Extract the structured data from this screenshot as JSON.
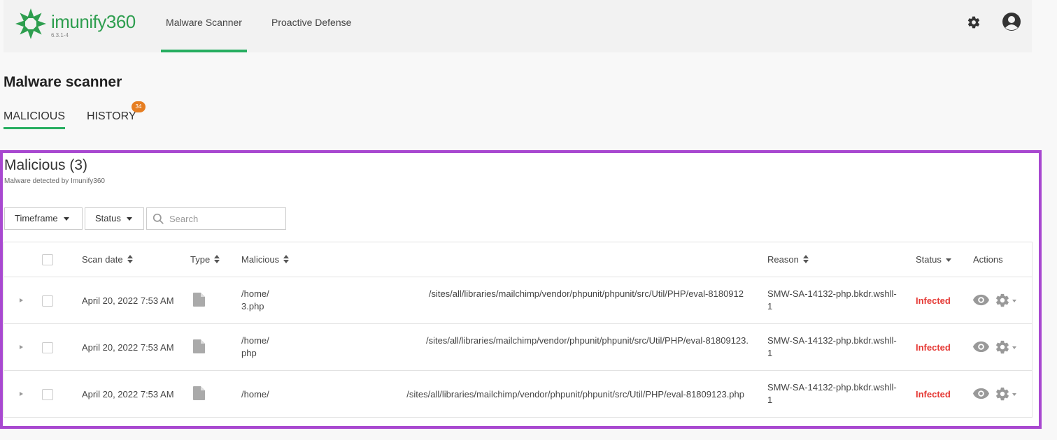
{
  "header": {
    "brand": "imunify360",
    "version": "6.3.1-4",
    "nav": [
      {
        "label": "Malware Scanner",
        "active": true
      },
      {
        "label": "Proactive Defense",
        "active": false
      }
    ],
    "icons": [
      "gear-icon",
      "user-avatar-icon"
    ]
  },
  "page": {
    "title": "Malware scanner",
    "tabs": [
      {
        "label": "MALICIOUS",
        "active": true
      },
      {
        "label": "HISTORY",
        "active": false,
        "badge": "34"
      }
    ]
  },
  "panel": {
    "title": "Malicious (3)",
    "subtitle": "Malware detected by Imunify360",
    "filters": {
      "timeframe": "Timeframe",
      "status": "Status",
      "search_placeholder": "Search"
    },
    "columns": {
      "scan_date": "Scan date",
      "type": "Type",
      "malicious": "Malicious",
      "reason": "Reason",
      "status": "Status",
      "actions": "Actions"
    },
    "rows": [
      {
        "scan_date": "April 20, 2022 7:53 AM",
        "path_left_1": "/home/",
        "path_left_2": "3.php",
        "path_right": "/sites/all/libraries/mailchimp/vendor/phpunit/phpunit/src/Util/PHP/eval-8180912",
        "reason_1": "SMW-SA-14132-php.bkdr.wshll-",
        "reason_2": "1",
        "status": "Infected"
      },
      {
        "scan_date": "April 20, 2022 7:53 AM",
        "path_left_1": "/home/",
        "path_left_2": "php",
        "path_right": "/sites/all/libraries/mailchimp/vendor/phpunit/phpunit/src/Util/PHP/eval-81809123.",
        "reason_1": "SMW-SA-14132-php.bkdr.wshll-",
        "reason_2": "1",
        "status": "Infected"
      },
      {
        "scan_date": "April 20, 2022 7:53 AM",
        "path_left_1": "/home/",
        "path_left_2": "",
        "path_right": "/sites/all/libraries/mailchimp/vendor/phpunit/phpunit/src/Util/PHP/eval-81809123.php",
        "reason_1": "SMW-SA-14132-php.bkdr.wshll-",
        "reason_2": "1",
        "status": "Infected"
      }
    ]
  },
  "colors": {
    "brand_green": "#2e9e4f",
    "active_tab": "#27ae60",
    "badge": "#e67e22",
    "infected": "#e53935",
    "highlight_border": "#a848d0"
  }
}
